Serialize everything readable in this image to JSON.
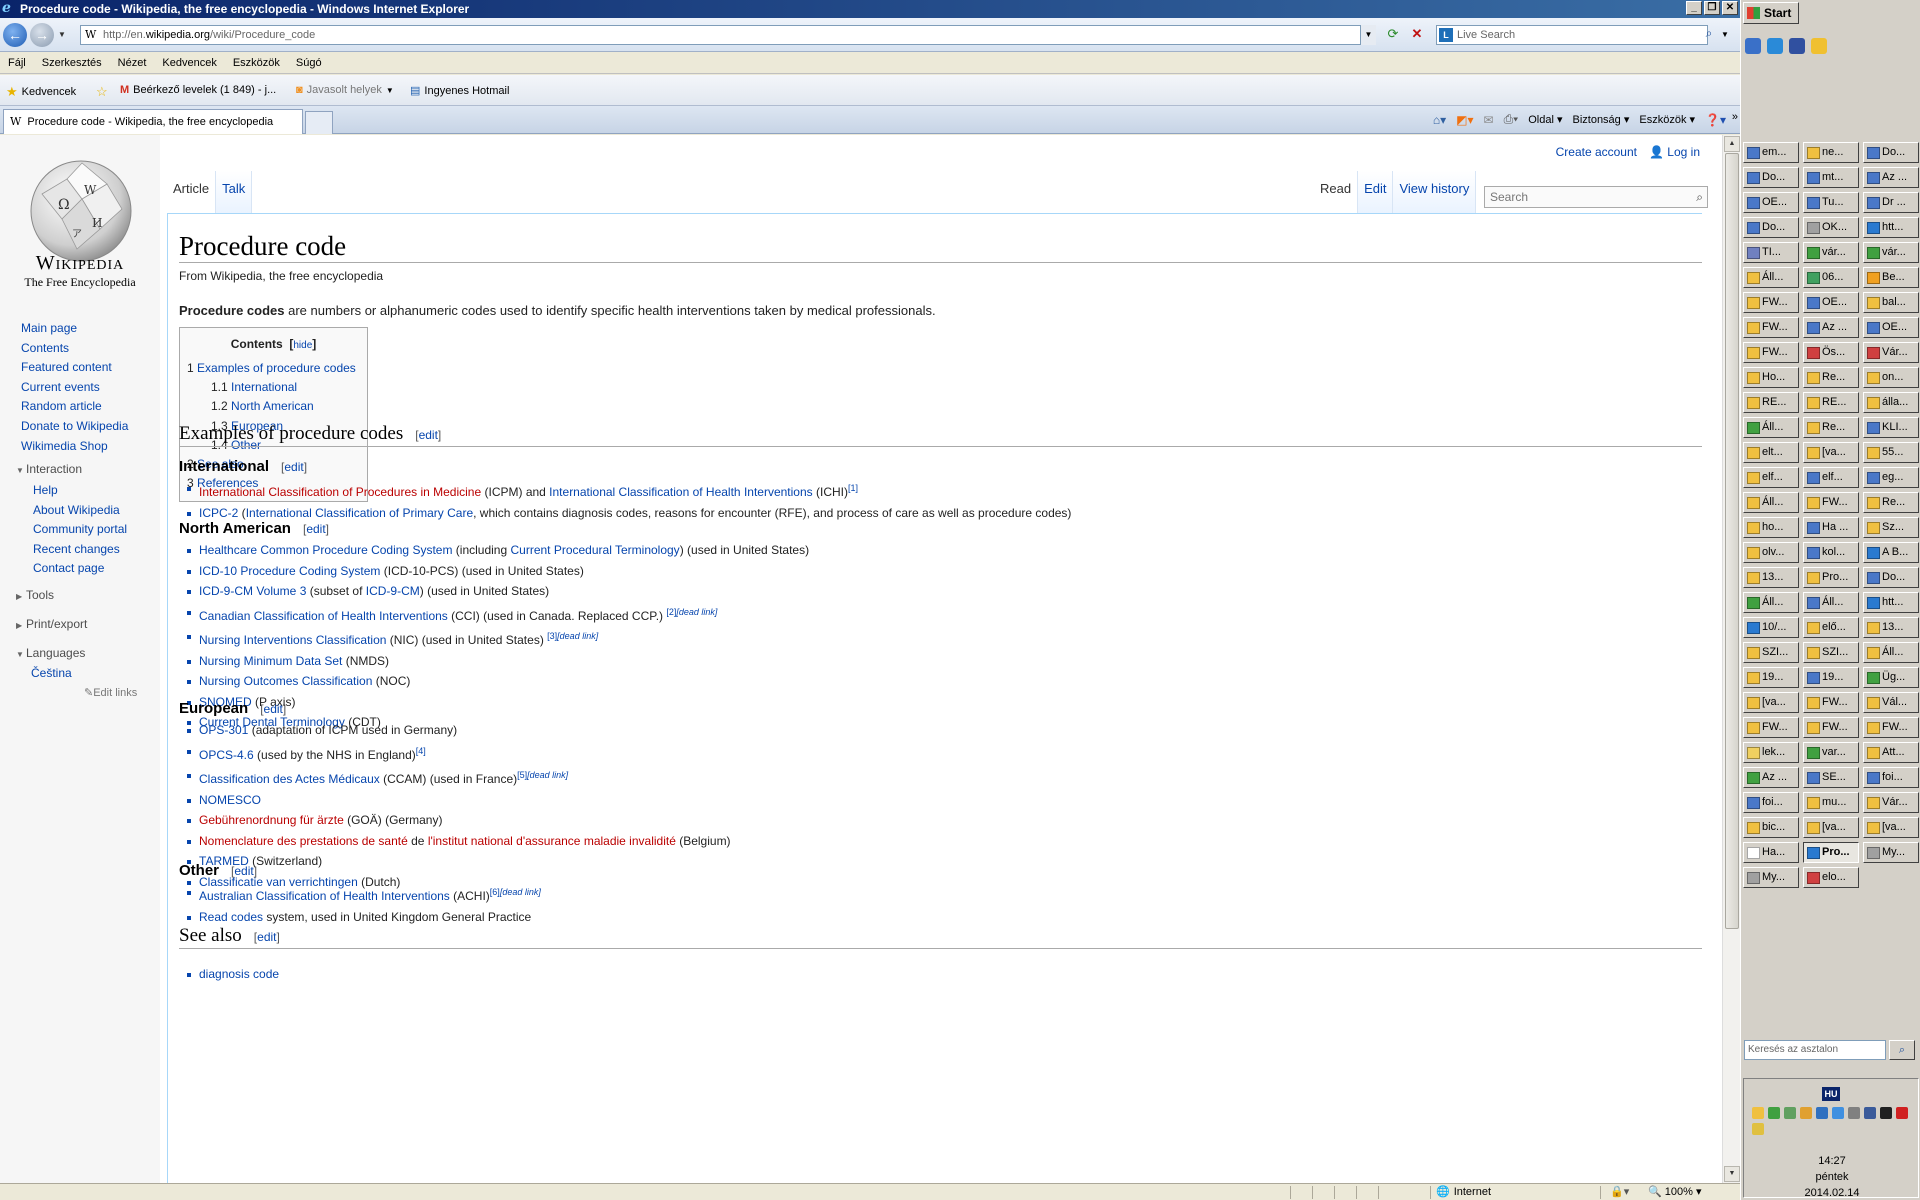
{
  "window": {
    "title": "Procedure code - Wikipedia, the free encyclopedia - Windows Internet Explorer"
  },
  "browser": {
    "address_prefix": "http://en.",
    "address_host": "wikipedia.org",
    "address_path": "/wiki/Procedure_code",
    "live_search_placeholder": "Live Search",
    "menu": [
      "Fájl",
      "Szerkesztés",
      "Nézet",
      "Kedvencek",
      "Eszközök",
      "Súgó"
    ],
    "favorites": {
      "label": "Kedvencek",
      "items": [
        "Beérkező levelek (1 849) - j...",
        "Javasolt helyek",
        "Ingyenes Hotmail"
      ]
    },
    "tab_title": "Procedure code - Wikipedia, the free encyclopedia",
    "commands": [
      "Oldal",
      "Biztonság",
      "Eszközök"
    ],
    "status": {
      "zone": "Internet",
      "zoom": "100%"
    }
  },
  "wiki": {
    "wordmark": "Wikipedia",
    "tagline": "The Free Encyclopedia",
    "nav_main": [
      "Main page",
      "Contents",
      "Featured content",
      "Current events",
      "Random article",
      "Donate to Wikipedia",
      "Wikimedia Shop"
    ],
    "interaction_heading": "Interaction",
    "interaction": [
      "Help",
      "About Wikipedia",
      "Community portal",
      "Recent changes",
      "Contact page"
    ],
    "tools_heading": "Tools",
    "print_heading": "Print/export",
    "languages_heading": "Languages",
    "languages": [
      "Čeština"
    ],
    "edit_links": "Edit links",
    "create_account": "Create account",
    "log_in": "Log in",
    "tabs_left": [
      "Article",
      "Talk"
    ],
    "tabs_right": [
      "Read",
      "Edit",
      "View history"
    ],
    "search_placeholder": "Search",
    "title": "Procedure code",
    "from": "From Wikipedia, the free encyclopedia",
    "lead_bold": "Procedure codes",
    "lead_rest": " are numbers or alphanumeric codes used to identify specific health interventions taken by medical professionals.",
    "toc": {
      "title": "Contents",
      "hide": "hide",
      "items": [
        {
          "num": "1",
          "text": "Examples of procedure codes",
          "level": 1
        },
        {
          "num": "1.1",
          "text": "International",
          "level": 2
        },
        {
          "num": "1.2",
          "text": "North American",
          "level": 2
        },
        {
          "num": "1.3",
          "text": "European",
          "level": 2
        },
        {
          "num": "1.4",
          "text": "Other",
          "level": 2
        },
        {
          "num": "2",
          "text": "See also",
          "level": 1
        },
        {
          "num": "3",
          "text": "References",
          "level": 1
        }
      ]
    },
    "edit": "edit",
    "h_examples": "Examples of procedure codes",
    "h_international": "International",
    "h_north_american": "North American",
    "h_european": "European",
    "h_other": "Other",
    "h_see_also": "See also",
    "international": [
      {
        "parts": [
          {
            "t": "International Classification of Procedures in Medicine",
            "c": "red"
          },
          {
            "t": " (ICPM) and "
          },
          {
            "t": "International Classification of Health Interventions",
            "c": "lk"
          },
          {
            "t": " (ICHI)"
          },
          {
            "t": "[1]",
            "c": "sup"
          }
        ]
      },
      {
        "parts": [
          {
            "t": "ICPC-2",
            "c": "lk"
          },
          {
            "t": " ("
          },
          {
            "t": "International Classification of Primary Care",
            "c": "lk"
          },
          {
            "t": ", which contains diagnosis codes, reasons for encounter (RFE), and process of care as well as procedure codes)"
          }
        ]
      }
    ],
    "north_american": [
      {
        "parts": [
          {
            "t": "Healthcare Common Procedure Coding System",
            "c": "lk"
          },
          {
            "t": " (including "
          },
          {
            "t": "Current Procedural Terminology",
            "c": "lk"
          },
          {
            "t": ") (used in United States)"
          }
        ]
      },
      {
        "parts": [
          {
            "t": "ICD-10 Procedure Coding System",
            "c": "lk"
          },
          {
            "t": " (ICD-10-PCS) (used in United States)"
          }
        ]
      },
      {
        "parts": [
          {
            "t": "ICD-9-CM Volume 3",
            "c": "lk"
          },
          {
            "t": " (subset of "
          },
          {
            "t": "ICD-9-CM",
            "c": "lk"
          },
          {
            "t": ") (used in United States)"
          }
        ]
      },
      {
        "parts": [
          {
            "t": "Canadian Classification of Health Interventions",
            "c": "lk"
          },
          {
            "t": " (CCI) (used in Canada. Replaced CCP.) "
          },
          {
            "t": "[2]",
            "c": "sup"
          },
          {
            "t": "[dead link]",
            "c": "supi"
          }
        ]
      },
      {
        "parts": [
          {
            "t": "Nursing Interventions Classification",
            "c": "lk"
          },
          {
            "t": " (NIC) (used in United States) "
          },
          {
            "t": "[3]",
            "c": "sup"
          },
          {
            "t": "[dead link]",
            "c": "supi"
          }
        ]
      },
      {
        "parts": [
          {
            "t": "Nursing Minimum Data Set",
            "c": "lk"
          },
          {
            "t": " (NMDS)"
          }
        ]
      },
      {
        "parts": [
          {
            "t": "Nursing Outcomes Classification",
            "c": "lk"
          },
          {
            "t": " (NOC)"
          }
        ]
      },
      {
        "parts": [
          {
            "t": "SNOMED",
            "c": "lk"
          },
          {
            "t": " (P axis)"
          }
        ]
      },
      {
        "parts": [
          {
            "t": "Current Dental Terminology",
            "c": "lk"
          },
          {
            "t": " (CDT)"
          }
        ]
      }
    ],
    "european": [
      {
        "parts": [
          {
            "t": "OPS-301",
            "c": "lk"
          },
          {
            "t": " (adaptation of ICPM used in Germany)"
          }
        ]
      },
      {
        "parts": [
          {
            "t": "OPCS-4.6",
            "c": "lk"
          },
          {
            "t": " (used by the NHS in England)"
          },
          {
            "t": "[4]",
            "c": "sup"
          }
        ]
      },
      {
        "parts": [
          {
            "t": "Classification des Actes Médicaux",
            "c": "lk"
          },
          {
            "t": " (CCAM) (used in France)"
          },
          {
            "t": "[5]",
            "c": "sup"
          },
          {
            "t": "[dead link]",
            "c": "supi"
          }
        ]
      },
      {
        "parts": [
          {
            "t": "NOMESCO",
            "c": "lk"
          }
        ]
      },
      {
        "parts": [
          {
            "t": "Gebührenordnung für ärzte",
            "c": "red"
          },
          {
            "t": " (GOÄ) (Germany)"
          }
        ]
      },
      {
        "parts": [
          {
            "t": "Nomenclature des prestations de santé",
            "c": "red"
          },
          {
            "t": " de "
          },
          {
            "t": "l'institut national d'assurance maladie invalidité",
            "c": "red"
          },
          {
            "t": " (Belgium)"
          }
        ]
      },
      {
        "parts": [
          {
            "t": "TARMED",
            "c": "lk"
          },
          {
            "t": " (Switzerland)"
          }
        ]
      },
      {
        "parts": [
          {
            "t": "Classificatie van verrichtingen",
            "c": "lk"
          },
          {
            "t": " (Dutch)"
          }
        ]
      }
    ],
    "other": [
      {
        "parts": [
          {
            "t": "Australian Classification of Health Interventions",
            "c": "lk"
          },
          {
            "t": " (ACHI)"
          },
          {
            "t": "[6]",
            "c": "sup"
          },
          {
            "t": "[dead link]",
            "c": "supi"
          }
        ]
      },
      {
        "parts": [
          {
            "t": "Read codes",
            "c": "lk"
          },
          {
            "t": " system, used in United Kingdom General Practice"
          }
        ]
      }
    ],
    "see_also_first": "diagnosis code"
  },
  "taskbar": {
    "start": "Start",
    "buttons": [
      {
        "label": "em...",
        "color": "#4a78c8"
      },
      {
        "label": "ne...",
        "color": "#f0c040"
      },
      {
        "label": "Do...",
        "color": "#4a78c8"
      },
      {
        "label": "Do...",
        "color": "#4a78c8"
      },
      {
        "label": "mt...",
        "color": "#4a78c8"
      },
      {
        "label": "Az ...",
        "color": "#4a78c8"
      },
      {
        "label": "OE...",
        "color": "#4a78c8"
      },
      {
        "label": "Tu...",
        "color": "#4a78c8"
      },
      {
        "label": "Dr ...",
        "color": "#4a78c8"
      },
      {
        "label": "Do...",
        "color": "#4a78c8"
      },
      {
        "label": "OK...",
        "color": "#a0a0a0"
      },
      {
        "label": "htt...",
        "color": "#2a7ad0"
      },
      {
        "label": "TI...",
        "color": "#7080c0"
      },
      {
        "label": "vár...",
        "color": "#40a040"
      },
      {
        "label": "vár...",
        "color": "#40a040"
      },
      {
        "label": "Áll...",
        "color": "#f0c040"
      },
      {
        "label": "06...",
        "color": "#40a060"
      },
      {
        "label": "Be...",
        "color": "#f0a020"
      },
      {
        "label": "FW...",
        "color": "#f0c040"
      },
      {
        "label": "OE...",
        "color": "#4a78c8"
      },
      {
        "label": "bal...",
        "color": "#f0c040"
      },
      {
        "label": "FW...",
        "color": "#f0c040"
      },
      {
        "label": "Az ...",
        "color": "#4a78c8"
      },
      {
        "label": "OE...",
        "color": "#4a78c8"
      },
      {
        "label": "FW...",
        "color": "#f0c040"
      },
      {
        "label": "Ös...",
        "color": "#d04040"
      },
      {
        "label": "Vár...",
        "color": "#d04040"
      },
      {
        "label": "Ho...",
        "color": "#f0c040"
      },
      {
        "label": "Re...",
        "color": "#f0c040"
      },
      {
        "label": "on...",
        "color": "#f0c040"
      },
      {
        "label": "RE...",
        "color": "#f0c040"
      },
      {
        "label": "RE...",
        "color": "#f0c040"
      },
      {
        "label": "álla...",
        "color": "#f0c040"
      },
      {
        "label": "Áll...",
        "color": "#40a040"
      },
      {
        "label": "Re...",
        "color": "#f0c040"
      },
      {
        "label": "KLI...",
        "color": "#4a78c8"
      },
      {
        "label": "elt...",
        "color": "#f0c040"
      },
      {
        "label": "[va...",
        "color": "#f0c040"
      },
      {
        "label": "55...",
        "color": "#f0c040"
      },
      {
        "label": "elf...",
        "color": "#f0c040"
      },
      {
        "label": "elf...",
        "color": "#4a78c8"
      },
      {
        "label": "eg...",
        "color": "#4a78c8"
      },
      {
        "label": "Áll...",
        "color": "#f0c040"
      },
      {
        "label": "FW...",
        "color": "#f0c040"
      },
      {
        "label": "Re...",
        "color": "#f0c040"
      },
      {
        "label": "ho...",
        "color": "#f0c040"
      },
      {
        "label": "Ha ...",
        "color": "#4a78c8"
      },
      {
        "label": "Sz...",
        "color": "#f0c040"
      },
      {
        "label": "olv...",
        "color": "#f0c040"
      },
      {
        "label": "kol...",
        "color": "#4a78c8"
      },
      {
        "label": "A B...",
        "color": "#2a7ad0"
      },
      {
        "label": "13...",
        "color": "#f0c040"
      },
      {
        "label": "Pro...",
        "color": "#f0c040"
      },
      {
        "label": "Do...",
        "color": "#4a78c8"
      },
      {
        "label": "Áll...",
        "color": "#40a040"
      },
      {
        "label": "Áll...",
        "color": "#4a78c8"
      },
      {
        "label": "htt...",
        "color": "#2a7ad0"
      },
      {
        "label": "10/...",
        "color": "#2a7ad0"
      },
      {
        "label": "elő...",
        "color": "#f0c040"
      },
      {
        "label": "13...",
        "color": "#f0c040"
      },
      {
        "label": "SZI...",
        "color": "#f0c040"
      },
      {
        "label": "SZI...",
        "color": "#f0c040"
      },
      {
        "label": "Áll...",
        "color": "#f0c040"
      },
      {
        "label": "19...",
        "color": "#f0c040"
      },
      {
        "label": "19...",
        "color": "#4a78c8"
      },
      {
        "label": "Üg...",
        "color": "#40a040"
      },
      {
        "label": "[va...",
        "color": "#f0c040"
      },
      {
        "label": "FW...",
        "color": "#f0c040"
      },
      {
        "label": "Vál...",
        "color": "#f0c040"
      },
      {
        "label": "FW...",
        "color": "#f0c040"
      },
      {
        "label": "FW...",
        "color": "#f0c040"
      },
      {
        "label": "FW...",
        "color": "#f0c040"
      },
      {
        "label": "lek...",
        "color": "#f0d060"
      },
      {
        "label": "var...",
        "color": "#40a040"
      },
      {
        "label": "Att...",
        "color": "#f0c040"
      },
      {
        "label": "Az ...",
        "color": "#40a040"
      },
      {
        "label": "SE...",
        "color": "#4a78c8"
      },
      {
        "label": "foi...",
        "color": "#4a78c8"
      },
      {
        "label": "foi...",
        "color": "#4a78c8"
      },
      {
        "label": "mu...",
        "color": "#f0c040"
      },
      {
        "label": "Vár...",
        "color": "#f0c040"
      },
      {
        "label": "bic...",
        "color": "#f0c040"
      },
      {
        "label": "[va...",
        "color": "#f0c040"
      },
      {
        "label": "[va...",
        "color": "#f0c040"
      },
      {
        "label": "Ha...",
        "color": "#ffffff"
      },
      {
        "label": "Pro...",
        "color": "#2a7ad0",
        "active": true
      },
      {
        "label": "My...",
        "color": "#a0a0a0"
      },
      {
        "label": "My...",
        "color": "#a0a0a0"
      },
      {
        "label": "elo...",
        "color": "#d04040"
      }
    ],
    "desk_search_placeholder": "Keresés az asztalon",
    "lang": "HU",
    "time": "14:27",
    "day": "péntek",
    "date": "2014.02.14"
  }
}
